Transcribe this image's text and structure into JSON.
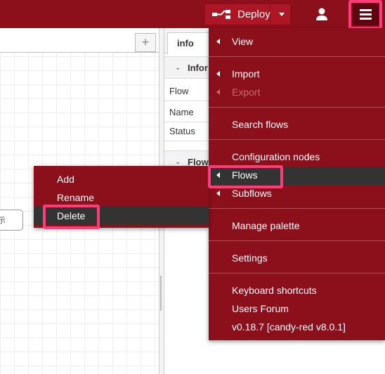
{
  "header": {
    "deploy_label": "Deploy",
    "colors": {
      "header_bg": "#8c101c",
      "deploy_bg": "#ad1625",
      "menu_button_bg": "#5e0610",
      "highlight": "#ff3b7a"
    },
    "icons": [
      "deploy-icon",
      "deploy-caret-icon",
      "user-icon",
      "hamburger-menu-icon"
    ]
  },
  "workspace": {
    "add_tab": "+",
    "node_label": "示"
  },
  "sidebar": {
    "tab_label": "info",
    "sections": {
      "info_title": "Infor",
      "flows_title": "Flow"
    },
    "rows": {
      "flow": "Flow",
      "name": "Name",
      "status": "Status"
    }
  },
  "main_menu": {
    "view": "View",
    "import": "Import",
    "export": "Export",
    "search_flows": "Search flows",
    "configuration_nodes": "Configuration nodes",
    "flows": "Flows",
    "subflows": "Subflows",
    "manage_palette": "Manage palette",
    "settings": "Settings",
    "keyboard_shortcuts": "Keyboard shortcuts",
    "users_forum": "Users Forum",
    "version": "v0.18.7 [candy-red v8.0.1]"
  },
  "flows_submenu": {
    "add": "Add",
    "rename": "Rename",
    "delete": "Delete"
  }
}
